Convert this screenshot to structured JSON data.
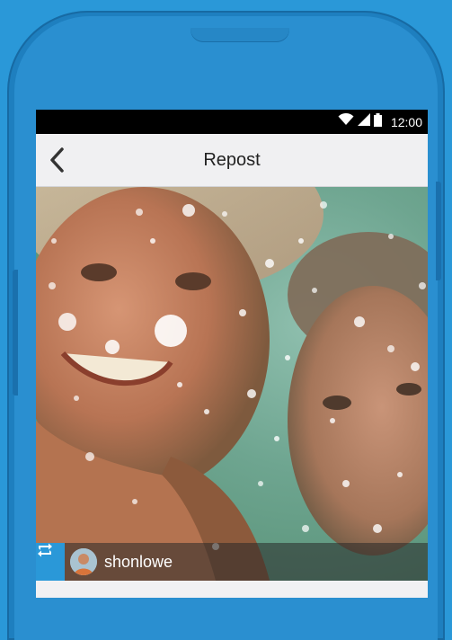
{
  "status_bar": {
    "time": "12:00",
    "icons": [
      "wifi-icon",
      "signal-icon",
      "battery-icon"
    ]
  },
  "app_bar": {
    "title": "Repost",
    "back_icon": "chevron-left-icon"
  },
  "post": {
    "username": "shonlowe",
    "repost_icon": "repost-icon"
  },
  "colors": {
    "background": "#2a98d8",
    "phone": "#1e7fbf",
    "status_bar": "#000000",
    "app_bar": "#f0f0f2",
    "accent": "#2a98d8"
  }
}
